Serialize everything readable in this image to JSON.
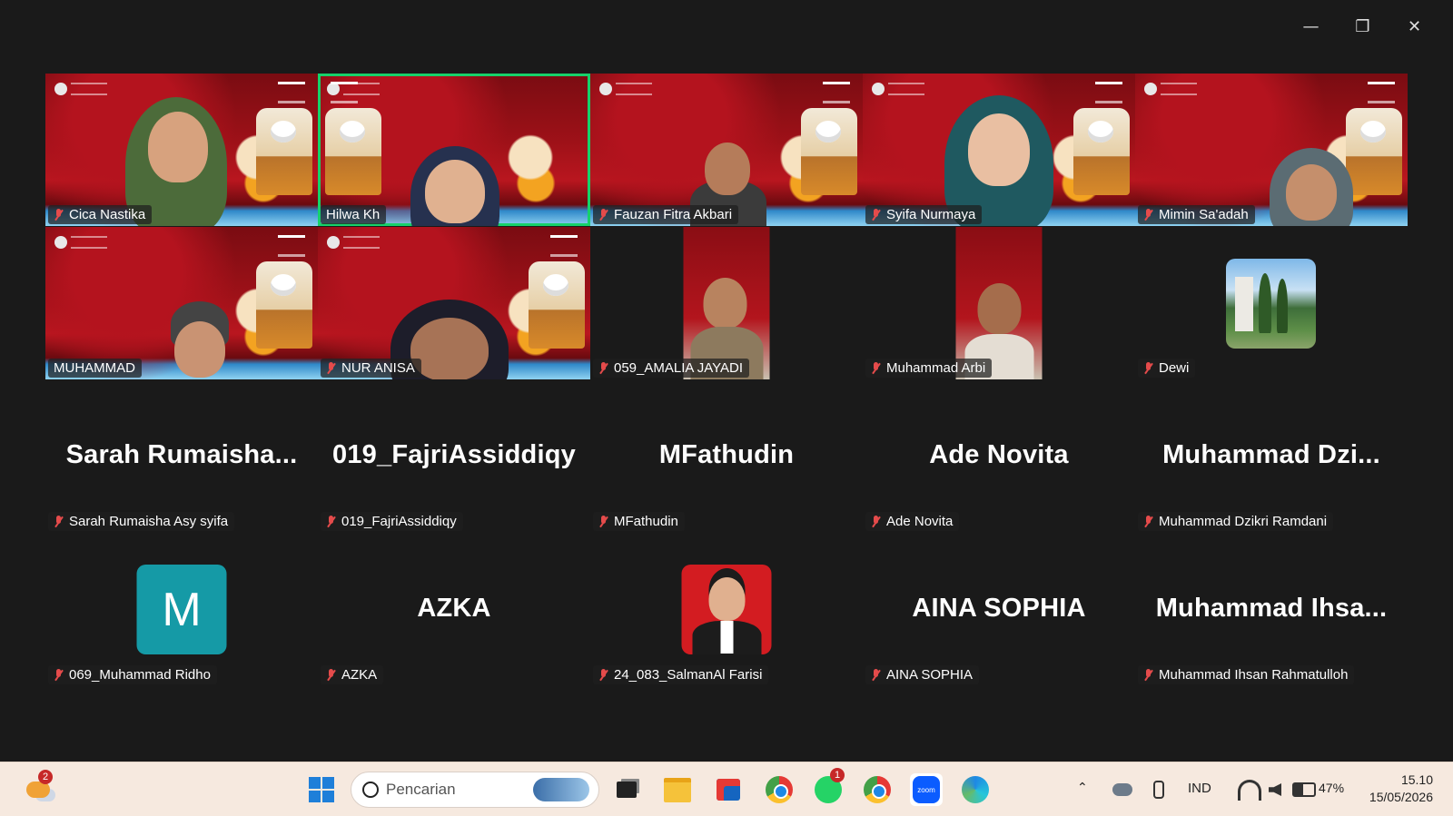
{
  "window": {
    "minimize_icon": "minimize-icon",
    "restore_icon": "restore-icon",
    "close_icon": "close-icon"
  },
  "video_tiles": [
    {
      "label": "Cica Nastika"
    },
    {
      "label": "Hilwa Kh",
      "active": true
    },
    {
      "label": "Fauzan Fitra Akbari"
    },
    {
      "label": "Syifa Nurmaya"
    },
    {
      "label": "Mimin Sa'adah"
    },
    {
      "label": "MUHAMMAD"
    },
    {
      "label": "NUR ANISA"
    },
    {
      "label": "059_AMALIA JAYADI"
    },
    {
      "label": "Muhammad Arbi"
    },
    {
      "label": "Dewi"
    }
  ],
  "name_tiles_row3": [
    {
      "display": "Sarah  Rumaisha...",
      "label": "Sarah Rumaisha Asy syifa"
    },
    {
      "display": "019_FajriAssiddiqy",
      "label": "019_FajriAssiddiqy"
    },
    {
      "display": "MFathudin",
      "label": "MFathudin"
    },
    {
      "display": "Ade Novita",
      "label": "Ade Novita"
    },
    {
      "display": "Muhammad  Dzi...",
      "label": "Muhammad Dzikri Ramdani"
    }
  ],
  "row4": [
    {
      "avatar_letter": "M",
      "avatar_color": "#159aa6",
      "label": "069_Muhammad Ridho"
    },
    {
      "display": "AZKA",
      "label": "AZKA"
    },
    {
      "avatar_photo": true,
      "avatar_color": "#d31c21",
      "label": "24_083_SalmanAl Farisi"
    },
    {
      "display": "AINA SOPHIA",
      "label": "AINA SOPHIA"
    },
    {
      "display": "Muhammad  Ihsa...",
      "label": "Muhammad Ihsan Rahmatulloh"
    }
  ],
  "taskbar": {
    "weather_badge": "2",
    "search_placeholder": "Pencarian",
    "whatsapp_badge": "1",
    "language": "IND",
    "battery": "47%",
    "time": "15.10",
    "date": "15/05/2026"
  },
  "colors": {
    "active_speaker": "#16d16a",
    "muted_mic": "#e54b4b"
  }
}
